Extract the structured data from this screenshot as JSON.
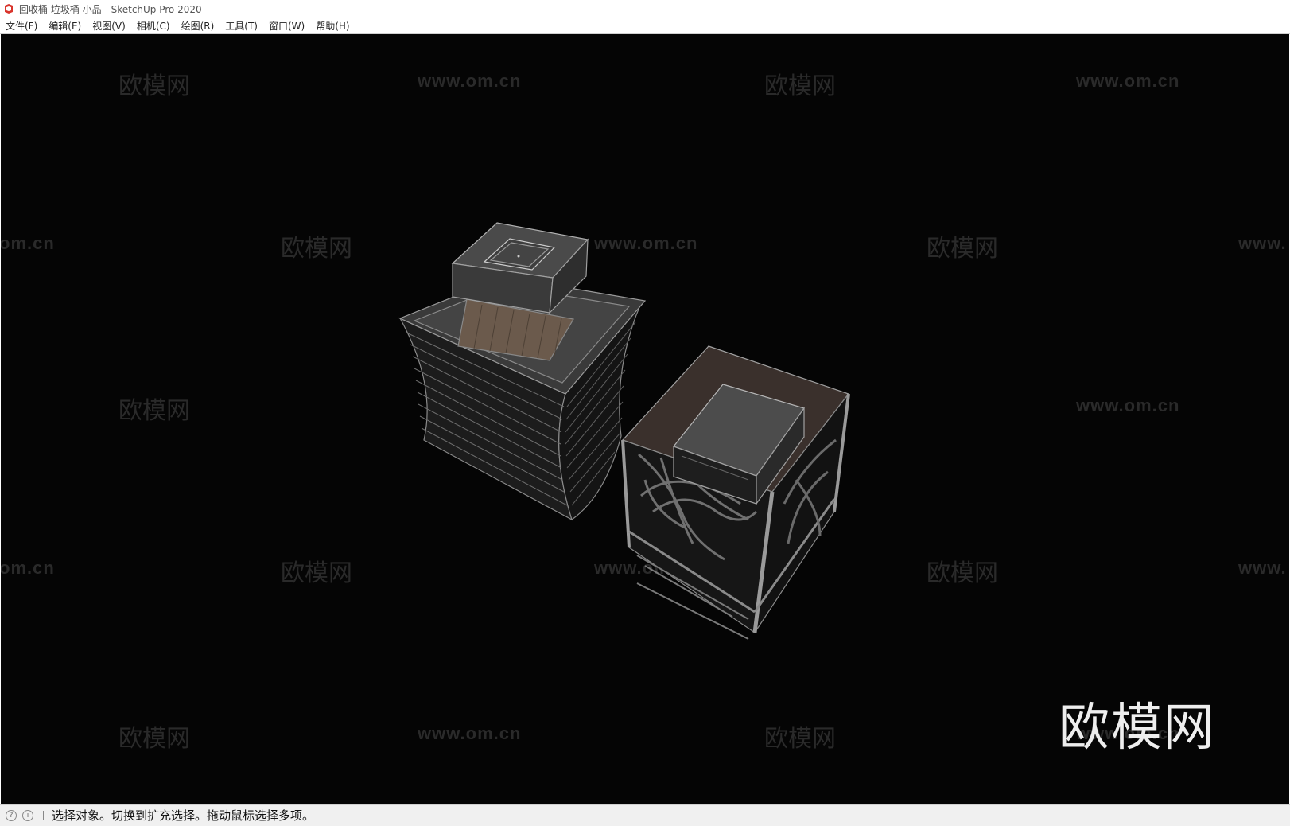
{
  "window": {
    "title": "回收桶 垃圾桶 小品 - SketchUp Pro 2020",
    "icon": "sketchup-logo-icon"
  },
  "menubar": {
    "items": [
      {
        "label": "文件(F)"
      },
      {
        "label": "编辑(E)"
      },
      {
        "label": "视图(V)"
      },
      {
        "label": "相机(C)"
      },
      {
        "label": "绘图(R)"
      },
      {
        "label": "工具(T)"
      },
      {
        "label": "窗口(W)"
      },
      {
        "label": "帮助(H)"
      }
    ]
  },
  "viewport": {
    "background": "#050505",
    "watermark_cn": "欧模网",
    "watermark_url": "www.om.cn",
    "watermark_url_cut": "om.cn",
    "watermark_url_cut_right": "www.",
    "logo_text": "欧模网"
  },
  "statusbar": {
    "icons": [
      "geolocation-icon",
      "info-icon"
    ],
    "text": "选择对象。切换到扩充选择。拖动鼠标选择多项。"
  }
}
